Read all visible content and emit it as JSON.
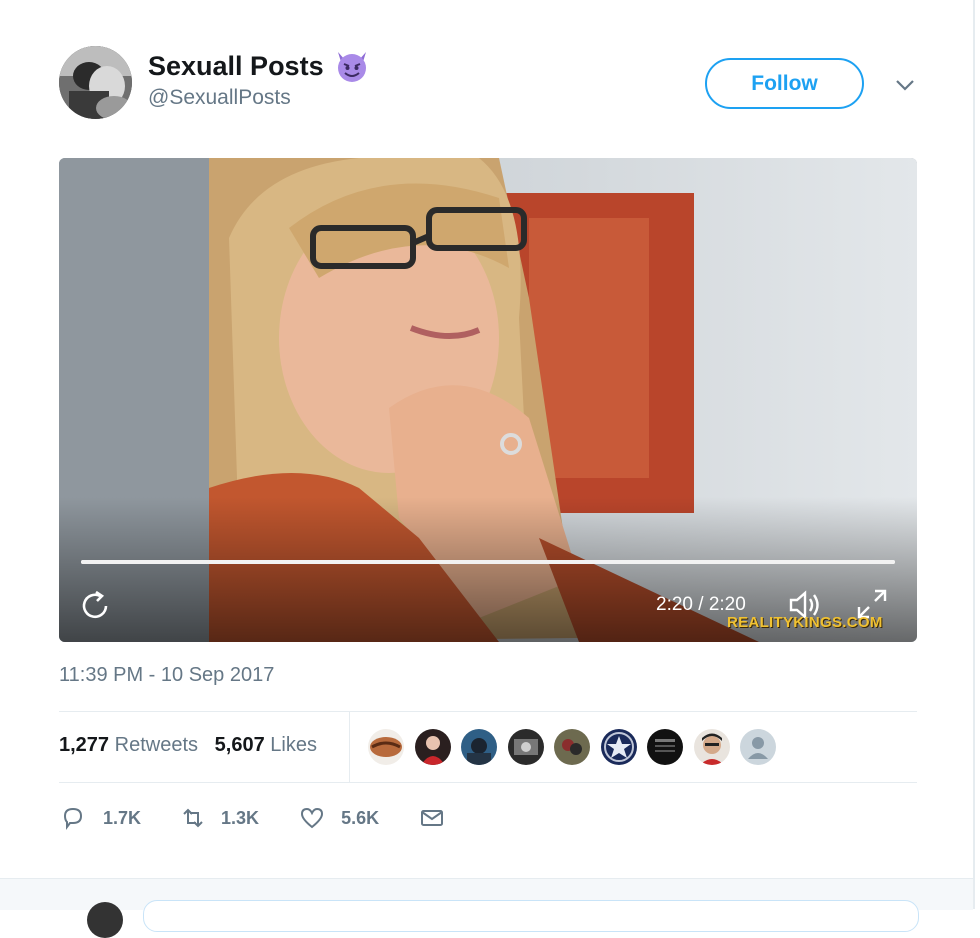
{
  "author": {
    "name": "Sexuall Posts",
    "handle": "@SexuallPosts",
    "follow_label": "Follow"
  },
  "media": {
    "time": "2:20 / 2:20",
    "progress": 1.0,
    "watermark": "REALITYKINGS.COM"
  },
  "tweet": {
    "timestamp": "11:39 PM - 10 Sep 2017"
  },
  "stats": {
    "retweets_count": "1,277",
    "retweets_label": "Retweets",
    "likes_count": "5,607",
    "likes_label": "Likes",
    "liker_avatars": 9
  },
  "actions": {
    "reply_count": "1.7K",
    "retweet_count": "1.3K",
    "like_count": "5.6K"
  },
  "colors": {
    "accent": "#1da1f2",
    "muted": "#657786"
  }
}
